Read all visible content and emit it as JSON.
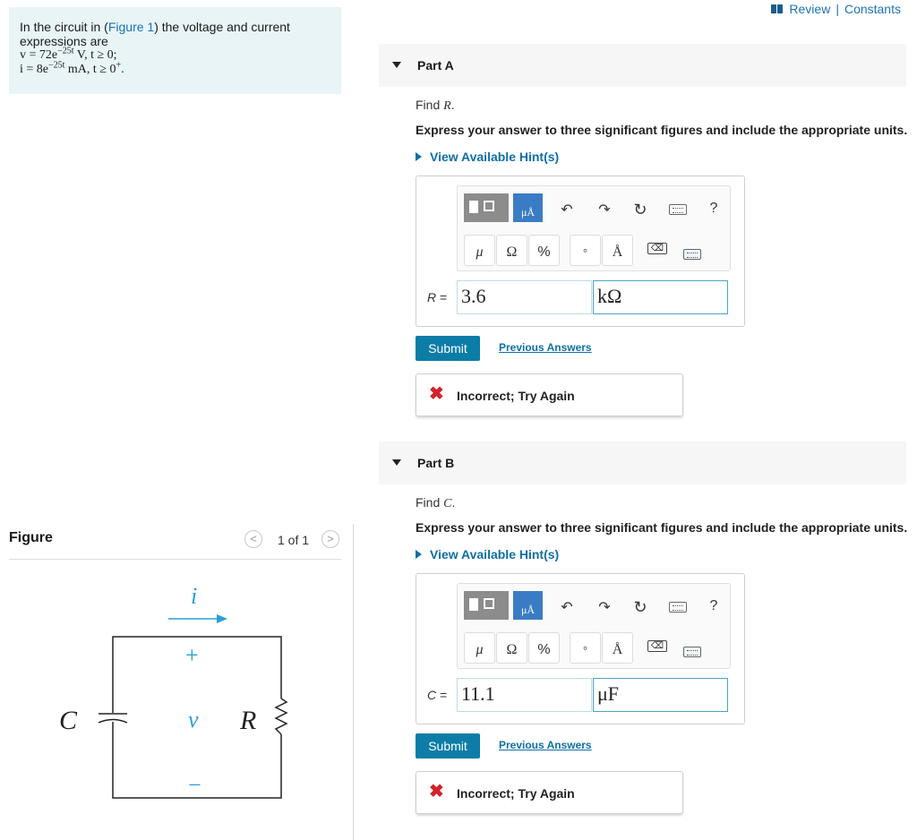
{
  "problem": {
    "intro_prefix": "In the circuit in (",
    "figure_link": "Figure 1",
    "intro_suffix": ") the voltage and current",
    "intro_line2": "expressions are",
    "v_eq": "v = 72e",
    "v_exp": "−25t",
    "v_rest": " V,   t ≥ 0;",
    "i_eq": "i = 8e",
    "i_exp": "−25t",
    "i_rest": " mA,   t ≥ 0",
    "i_sup": "+",
    "i_end": "."
  },
  "header": {
    "review_label": "Review",
    "separator": "|",
    "constants_label": "Constants"
  },
  "figure": {
    "label": "Figure",
    "pager_text": "1 of 1",
    "prev_glyph": "<",
    "next_glyph": ">",
    "circuit": {
      "current_label": "i",
      "plus": "+",
      "minus": "−",
      "voltage_label": "v",
      "cap_label": "C",
      "res_label": "R"
    }
  },
  "toolbar": {
    "template_glyph": "μÅ",
    "undo": "↶",
    "redo": "↷",
    "reset": "↻",
    "help": "?",
    "keys": [
      "μ",
      "Ω",
      "%",
      "°",
      "Å"
    ],
    "backspace": "⌫"
  },
  "parts": [
    {
      "title": "Part A",
      "find_prefix": "Find ",
      "find_var": "R",
      "find_suffix": ".",
      "instruction": "Express your answer to three significant figures and include the appropriate units.",
      "hint_label": "View Available Hint(s)",
      "var_label": "R",
      "equals": " =",
      "value": "3.6",
      "unit": "kΩ",
      "submit_label": "Submit",
      "previous_label": "Previous Answers",
      "feedback_icon": "✖",
      "feedback": "Incorrect; Try Again"
    },
    {
      "title": "Part B",
      "find_prefix": "Find ",
      "find_var": "C",
      "find_suffix": ".",
      "instruction": "Express your answer to three significant figures and include the appropriate units.",
      "hint_label": "View Available Hint(s)",
      "var_label": "C",
      "equals": " =",
      "value": "11.1",
      "unit": "μF",
      "submit_label": "Submit",
      "previous_label": "Previous Answers",
      "feedback_icon": "✖",
      "feedback": "Incorrect; Try Again"
    }
  ],
  "colors": {
    "accent": "#0b7da7",
    "link": "#1a73b5",
    "error": "#d4212b",
    "problem_bg": "#e8f4f5",
    "circuit_arrow": "#2a9fd8"
  }
}
